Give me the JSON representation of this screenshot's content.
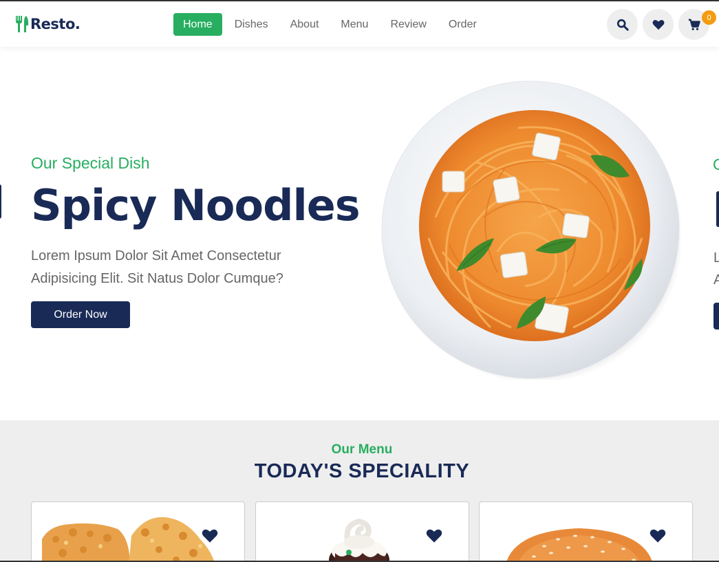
{
  "brand": {
    "name": "Resto."
  },
  "nav": {
    "items": [
      {
        "label": "Home",
        "active": true
      },
      {
        "label": "Dishes",
        "active": false
      },
      {
        "label": "About",
        "active": false
      },
      {
        "label": "Menu",
        "active": false
      },
      {
        "label": "Review",
        "active": false
      },
      {
        "label": "Order",
        "active": false
      }
    ]
  },
  "header_icons": {
    "search": "search-icon",
    "favorites": "heart-icon",
    "cart": "cart-icon",
    "cart_count": "0"
  },
  "hero": {
    "subtitle": "Our Special Dish",
    "title": "Spicy Noodles",
    "description_line1": "Lorem Ipsum Dolor Sit Amet Consectetur",
    "description_line2": "Adipisicing Elit. Sit Natus Dolor Cumque?",
    "button": "Order Now"
  },
  "next_slide_peek": {
    "subtitle": "O",
    "line1": "L",
    "line2": "A"
  },
  "menu": {
    "subtitle": "Our Menu",
    "title": "TODAY'S SPECIALITY",
    "cards": [
      {
        "image": "fried-chicken",
        "icon": "heart-icon"
      },
      {
        "image": "dessert-cup",
        "icon": "heart-icon"
      },
      {
        "image": "burger",
        "icon": "heart-icon"
      }
    ]
  },
  "colors": {
    "accent": "#27ae60",
    "navy": "#192a56",
    "text": "#666666",
    "badge": "#f39c12",
    "section_bg": "#eeeeee"
  }
}
